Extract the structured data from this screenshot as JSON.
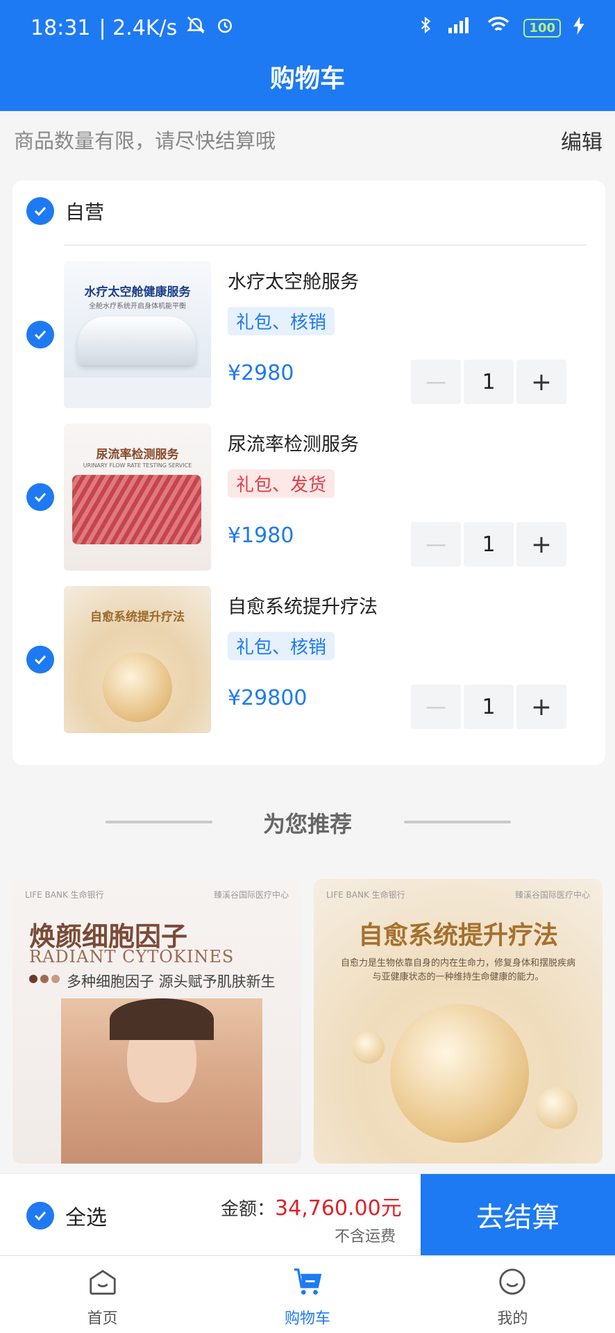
{
  "status": {
    "time": "18:31",
    "speed": "| 2.4K/s",
    "battery": "100"
  },
  "page_title": "购物车",
  "notice": "商品数量有限，请尽快结算哦",
  "edit_label": "编辑",
  "store": {
    "name": "自营"
  },
  "items": [
    {
      "thumb_title": "水疗太空舱健康服务",
      "thumb_sub": "全舱水疗系统开启身体机能平衡",
      "name": "水疗太空舱服务",
      "tag": "礼包、核销",
      "price": "¥2980",
      "qty": "1"
    },
    {
      "thumb_title": "尿流率检测服务",
      "thumb_sub": "URINARY FLOW RATE TESTING SERVICE",
      "name": "尿流率检测服务",
      "tag": "礼包、发货",
      "price": "¥1980",
      "qty": "1"
    },
    {
      "thumb_title": "自愈系统提升疗法",
      "thumb_sub": "",
      "name": "自愈系统提升疗法",
      "tag": "礼包、核销",
      "price": "¥29800",
      "qty": "1"
    }
  ],
  "stepper": {
    "minus": "—",
    "plus": "+"
  },
  "recommend_title": "为您推荐",
  "recommend": [
    {
      "brand": "LIFE BANK 生命银行",
      "brand2": "臻溪谷国际医疗中心",
      "title": "焕颜细胞因子",
      "en": "RADIANT CYTOKINES",
      "desc": "多种细胞因子  源头赋予肌肤新生"
    },
    {
      "brand": "LIFE BANK 生命银行",
      "brand2": "臻溪谷国际医疗中心",
      "title": "自愈系统提升疗法",
      "en": "",
      "desc": "自愈力是生物依靠自身的内在生命力，修复身体和摆脱疾病与亚健康状态的一种维持生命健康的能力。"
    }
  ],
  "bottom": {
    "select_all": "全选",
    "amount_label": "金额：",
    "amount_value": "34,760.00元",
    "shipping": "不含运费",
    "checkout": "去结算"
  },
  "tabs": [
    {
      "label": "首页",
      "icon": "home-icon"
    },
    {
      "label": "购物车",
      "icon": "cart-icon"
    },
    {
      "label": "我的",
      "icon": "profile-icon"
    }
  ],
  "colors": {
    "accent": "#1e7af2",
    "price_red": "#e0202a"
  }
}
